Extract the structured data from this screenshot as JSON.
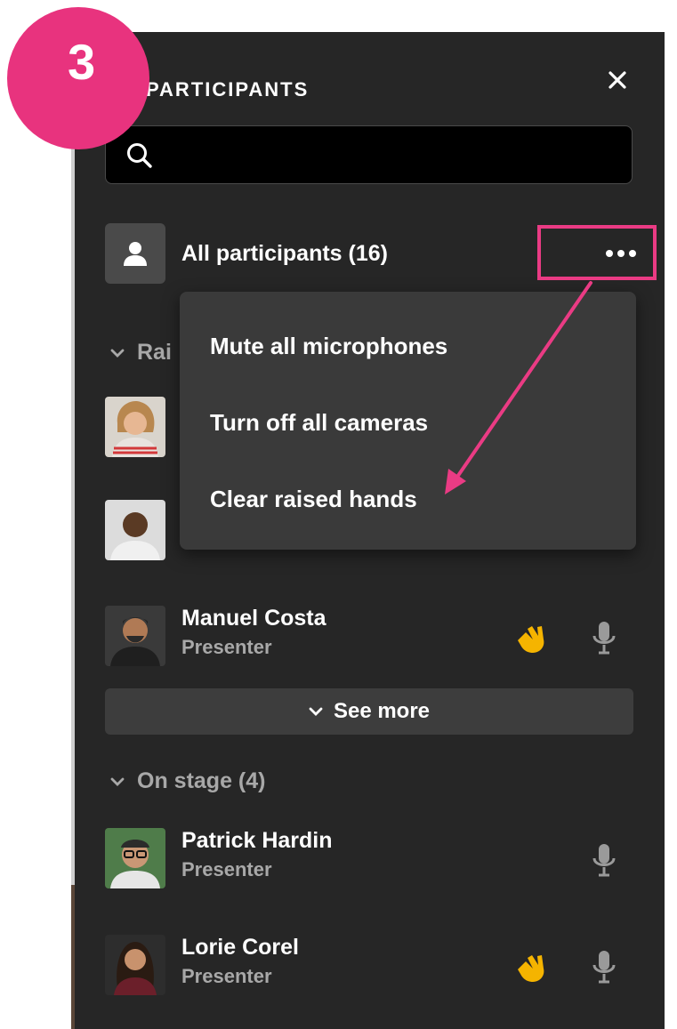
{
  "step": {
    "number": "3"
  },
  "panel": {
    "title": "PARTICIPANTS",
    "search_placeholder": "",
    "all_participants_label": "All participants (16)"
  },
  "menu": {
    "items": [
      {
        "label": "Mute all microphones"
      },
      {
        "label": "Turn off all cameras"
      },
      {
        "label": "Clear raised hands"
      }
    ]
  },
  "sections": {
    "raised": {
      "label": "Rai"
    },
    "on_stage": {
      "label": "On stage (4)"
    }
  },
  "people": [
    {
      "name": "Manuel Costa",
      "role": "Presenter",
      "hand_raised": true
    },
    {
      "name": "Patrick Hardin",
      "role": "Presenter",
      "hand_raised": false
    },
    {
      "name": "Lorie Corel",
      "role": "Presenter",
      "hand_raised": true
    }
  ],
  "see_more": {
    "label": "See more"
  },
  "colors": {
    "panel_bg": "#262626",
    "accent_pink": "#ea3b84",
    "hand_yellow": "#f5b400",
    "muted_text": "#a8a8a8"
  },
  "icons": [
    "close-icon",
    "search-icon",
    "person-icon",
    "more-icon",
    "chevron-down-icon",
    "raised-hand-icon",
    "microphone-icon"
  ]
}
